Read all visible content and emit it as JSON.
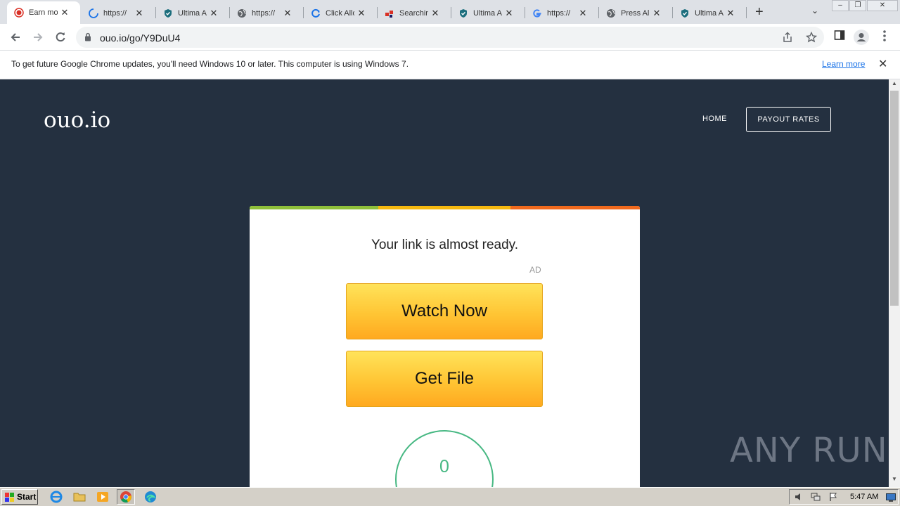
{
  "browser": {
    "tabs": [
      {
        "title": "Earn mo",
        "icon": "record-icon",
        "active": true
      },
      {
        "title": "https://",
        "icon": "loading-icon"
      },
      {
        "title": "Ultima A",
        "icon": "shield-icon"
      },
      {
        "title": "https://",
        "icon": "globe-icon"
      },
      {
        "title": "Click Allo",
        "icon": "refresh-icon"
      },
      {
        "title": "Searchin",
        "icon": "squares-icon"
      },
      {
        "title": "Ultima A",
        "icon": "shield-icon"
      },
      {
        "title": "https://",
        "icon": "google-icon"
      },
      {
        "title": "Press All",
        "icon": "globe-icon"
      },
      {
        "title": "Ultima A",
        "icon": "shield-icon"
      }
    ],
    "url": "ouo.io/go/Y9DuU4",
    "infobar": {
      "message": "To get future Google Chrome updates, you'll need Windows 10 or later. This computer is using Windows 7.",
      "link": "Learn more"
    }
  },
  "page": {
    "logo": "ouo.io",
    "nav": {
      "home": "HOME",
      "payout": "PAYOUT RATES"
    },
    "card": {
      "title": "Your link is almost ready.",
      "ad_label": "AD",
      "watch_button": "Watch Now",
      "get_button": "Get File",
      "countdown": "0"
    },
    "colors": {
      "bar1": "#8fbf3a",
      "bar2": "#f5b80f",
      "bar3": "#f0691d",
      "ring": "#47b883",
      "background": "#243040"
    }
  },
  "watermark": "ANY RUN",
  "taskbar": {
    "start": "Start",
    "clock": "5:47 AM"
  }
}
